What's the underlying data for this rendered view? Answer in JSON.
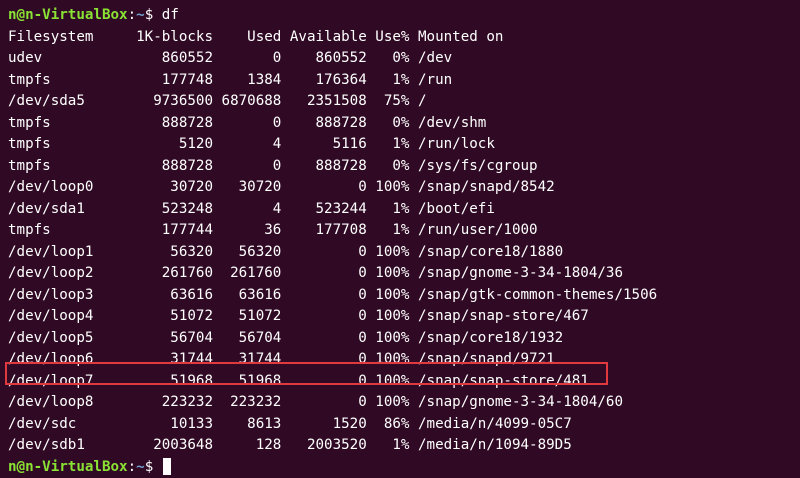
{
  "prompt": {
    "user": "n@n-VirtualBox",
    "sep": ":",
    "path": "~",
    "symbol": "$ "
  },
  "command": "df",
  "header": "Filesystem     1K-blocks    Used Available Use% Mounted on",
  "rows": [
    "udev              860552       0    860552   0% /dev",
    "tmpfs             177748    1384    176364   1% /run",
    "/dev/sda5        9736500 6870688   2351508  75% /",
    "tmpfs             888728       0    888728   0% /dev/shm",
    "tmpfs               5120       4      5116   1% /run/lock",
    "tmpfs             888728       0    888728   0% /sys/fs/cgroup",
    "/dev/loop0         30720   30720         0 100% /snap/snapd/8542",
    "/dev/sda1         523248       4    523244   1% /boot/efi",
    "tmpfs             177744      36    177708   1% /run/user/1000",
    "/dev/loop1         56320   56320         0 100% /snap/core18/1880",
    "/dev/loop2        261760  261760         0 100% /snap/gnome-3-34-1804/36",
    "/dev/loop3         63616   63616         0 100% /snap/gtk-common-themes/1506",
    "/dev/loop4         51072   51072         0 100% /snap/snap-store/467",
    "/dev/loop5         56704   56704         0 100% /snap/core18/1932",
    "/dev/loop6         31744   31744         0 100% /snap/snapd/9721",
    "/dev/loop7         51968   51968         0 100% /snap/snap-store/481",
    "/dev/loop8        223232  223232         0 100% /snap/gnome-3-34-1804/60",
    "/dev/sdc           10133    8613      1520  86% /media/n/4099-05C7",
    "/dev/sdb1        2003648     128   2003520   1% /media/n/1094-89D5"
  ],
  "colors": {
    "background": "#300a24",
    "user": "#8ae234",
    "path": "#729fcf",
    "highlight": "#e0393e"
  }
}
